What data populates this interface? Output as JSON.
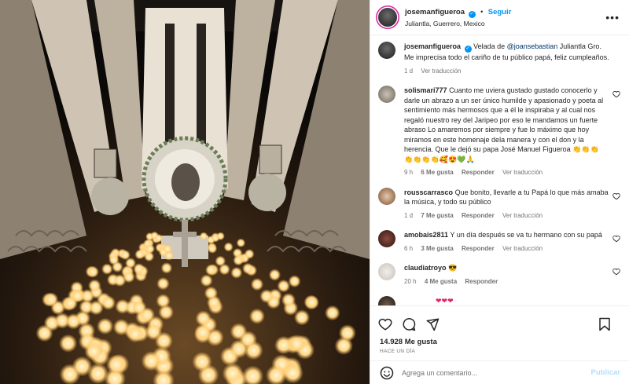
{
  "post": {
    "username": "josemanfigueroa",
    "follow_label": "Seguir",
    "location": "Juliantla, Guerrero, Mexico",
    "caption_text": "Velada de ",
    "caption_mention": "@joansebastian",
    "caption_rest": " Juliantla Gro. Me imprecisa todo el cariño de tu público papá, feliz cumpleaños.",
    "caption_time": "1 d",
    "caption_translate": "Ver traducción"
  },
  "comments": [
    {
      "username": "solismari777",
      "text": "Cuanto me uviera gustado gustado conocerlo y darle un abrazo a un ser único humilde y apasionado y poeta al sentimiento más hermosos que a él le inspiraba y al cual nos regaló nuestro rey del Jaripeo por eso le mandamos un fuerte abraso Lo amaremos por siempre y fue lo máximo que hoy miramos en este homenaje dela manera y con el don y la herencia. Que le dejó su papa José Manuel Figueroa 👏👏👏 👏👏👏👏🥰😍💚🙏",
      "time": "9 h",
      "likes": "6 Me gusta",
      "reply": "Responder",
      "translate": "Ver traducción"
    },
    {
      "username": "rousscarrasco",
      "text": "Que bonito, llevarle a tu Papá lo que más amaba la música, y todo su público",
      "time": "1 d",
      "likes": "7 Me gusta",
      "reply": "Responder",
      "translate": "Ver traducción"
    },
    {
      "username": "amobais2811",
      "text": "Y un día después se va tu hermano con su papá",
      "time": "6 h",
      "likes": "3 Me gusta",
      "reply": "Responder",
      "translate": "Ver traducción"
    },
    {
      "username": "claudiatroyo",
      "text": "😎",
      "time": "20 h",
      "likes": "4 Me gusta",
      "reply": "Responder",
      "translate": ""
    },
    {
      "username": "",
      "text": "❤❤❤",
      "time": "",
      "likes": "",
      "reply": "",
      "translate": ""
    }
  ],
  "actions": {
    "likes_count": "14.928 Me gusta",
    "posted_ago": "HACE UN DÍA",
    "comment_placeholder": "Agrega un comentario...",
    "publish_label": "Publicar"
  },
  "icons": {
    "more": "more-options-icon",
    "like": "heart-icon",
    "comment": "comment-icon",
    "share": "share-icon",
    "save": "bookmark-icon",
    "emoji": "emoji-icon",
    "verified": "verified-badge-icon"
  },
  "colors": {
    "link": "#0095f6",
    "mention": "#00376b",
    "muted": "#737373",
    "publish_disabled": "#b2dffc"
  }
}
